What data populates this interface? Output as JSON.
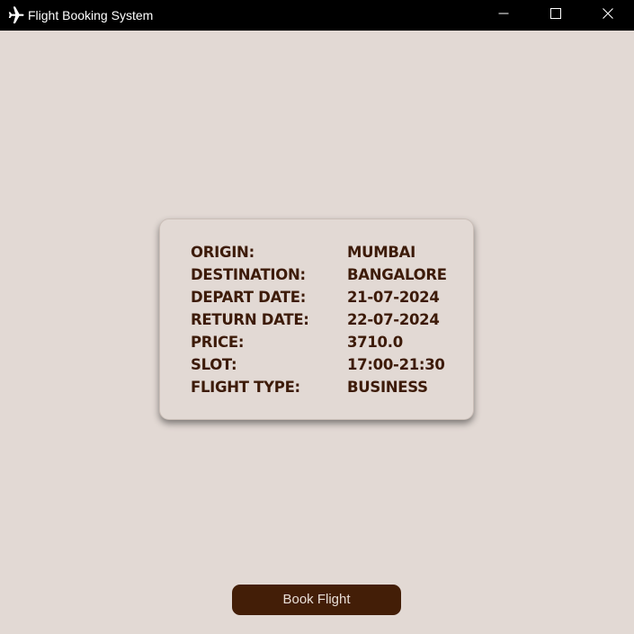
{
  "window": {
    "title": "Flight Booking System",
    "icon": "airplane-icon",
    "controls": [
      "minimize-icon",
      "maximize-icon",
      "close-icon"
    ]
  },
  "details": {
    "rows": [
      {
        "label": "ORIGIN:",
        "value": "MUMBAI"
      },
      {
        "label": "DESTINATION:",
        "value": "BANGALORE"
      },
      {
        "label": "DEPART DATE:",
        "value": "21-07-2024"
      },
      {
        "label": "RETURN DATE:",
        "value": "22-07-2024"
      },
      {
        "label": "PRICE:",
        "value": "3710.0"
      },
      {
        "label": "SLOT:",
        "value": "17:00-21:30"
      },
      {
        "label": "FLIGHT TYPE:",
        "value": "BUSINESS"
      }
    ]
  },
  "actions": {
    "book_label": "Book Flight"
  },
  "colors": {
    "background": "#e2d9d4",
    "titlebar": "#000000",
    "text_accent": "#3d1b09",
    "button": "#431e07",
    "button_text": "#e9dfd8"
  }
}
